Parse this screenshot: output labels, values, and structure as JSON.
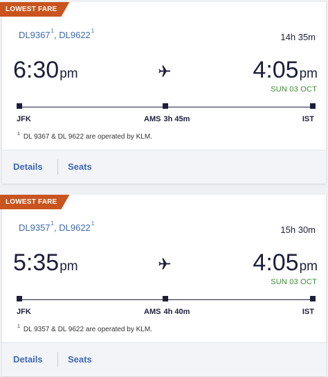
{
  "results": [
    {
      "badge": "LOWEST FARE",
      "flight_1": "DL9367",
      "flight_1_sup": "1",
      "separator": ",",
      "flight_2": "DL9622",
      "flight_2_sup": "1",
      "duration": "14h 35m",
      "dep_time": "6:30",
      "dep_ampm": "pm",
      "arr_time": "4:05",
      "arr_ampm": "pm",
      "arr_date": "SUN 03 OCT",
      "origin": "JFK",
      "stop": "AMS",
      "layover": "3h 45m",
      "destination": "IST",
      "note_sup": "1",
      "note": "DL 9367 & DL 9622 are operated by KLM.",
      "details_label": "Details",
      "seats_label": "Seats"
    },
    {
      "badge": "LOWEST FARE",
      "flight_1": "DL9357",
      "flight_1_sup": "1",
      "separator": ",",
      "flight_2": "DL9622",
      "flight_2_sup": "1",
      "duration": "15h 30m",
      "dep_time": "5:35",
      "dep_ampm": "pm",
      "arr_time": "4:05",
      "arr_ampm": "pm",
      "arr_date": "SUN 03 OCT",
      "origin": "JFK",
      "stop": "AMS",
      "layover": "4h 40m",
      "destination": "IST",
      "note_sup": "1",
      "note": "DL 9357 & DL 9622 are operated by KLM.",
      "details_label": "Details",
      "seats_label": "Seats"
    }
  ],
  "icons": {
    "plane": "airplane-icon"
  },
  "colors": {
    "badge": "#c9541d",
    "link": "#3c68b3",
    "text": "#1d1e3b",
    "date": "#3a8a32"
  }
}
